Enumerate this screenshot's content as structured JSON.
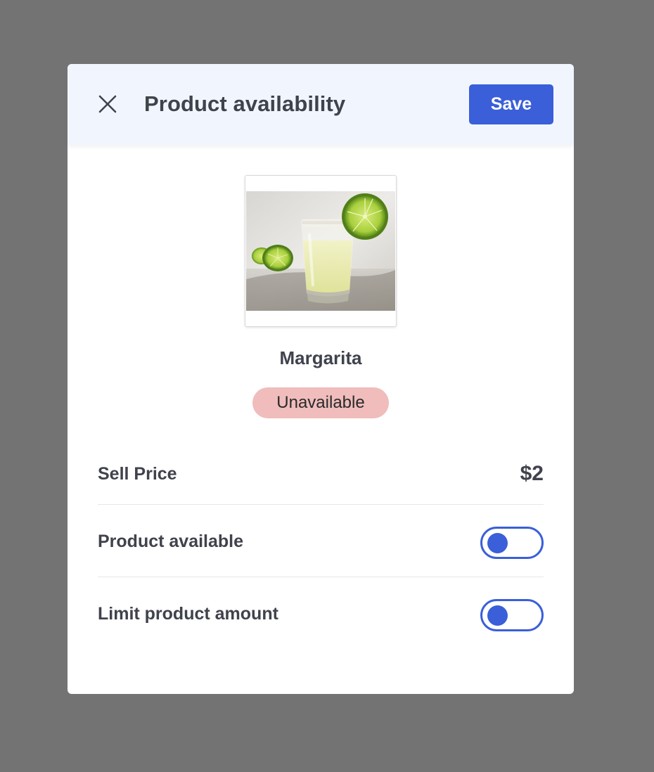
{
  "modal": {
    "title": "Product availability",
    "save_label": "Save",
    "close_icon": "close-icon"
  },
  "product": {
    "name": "Margarita",
    "image_icon": "margarita-image",
    "status": "Unavailable",
    "status_color": "#f0bcbc"
  },
  "details": {
    "sell_price_label": "Sell Price",
    "sell_price_value": "$2",
    "product_available_label": "Product available",
    "product_available_on": false,
    "limit_amount_label": "Limit product amount",
    "limit_amount_on": false
  },
  "colors": {
    "accent": "#3a5fd9",
    "header_bg": "#f1f6fe",
    "overlay": "#737373",
    "text": "#40424c"
  }
}
